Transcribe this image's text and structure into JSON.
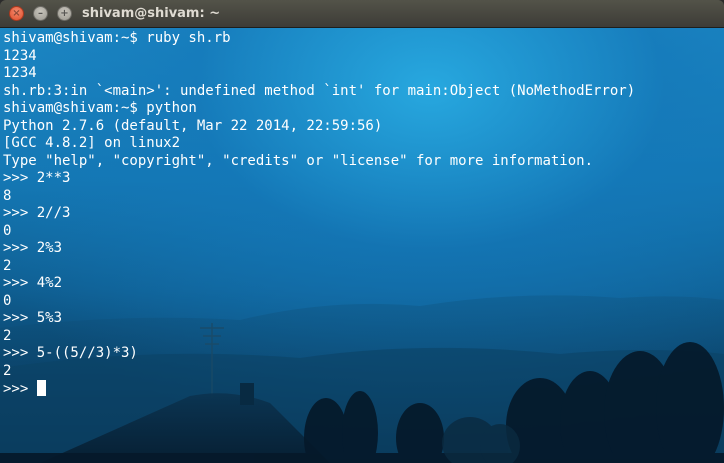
{
  "window": {
    "title": "shivam@shivam: ~",
    "close_glyph": "×",
    "minimize_glyph": "–",
    "maximize_glyph": "+"
  },
  "terminal": {
    "lines": [
      "shivam@shivam:~$ ruby sh.rb",
      "1234",
      "1234",
      "sh.rb:3:in `<main>': undefined method `int' for main:Object (NoMethodError)",
      "shivam@shivam:~$ python",
      "Python 2.7.6 (default, Mar 22 2014, 22:59:56)",
      "[GCC 4.8.2] on linux2",
      "Type \"help\", \"copyright\", \"credits\" or \"license\" for more information.",
      ">>> 2**3",
      "8",
      ">>> 2//3",
      "0",
      ">>> 2%3",
      "2",
      ">>> 4%2",
      "0",
      ">>> 5%3",
      "2",
      ">>> 5-((5//3)*3)",
      "2"
    ],
    "prompt": ">>> "
  }
}
